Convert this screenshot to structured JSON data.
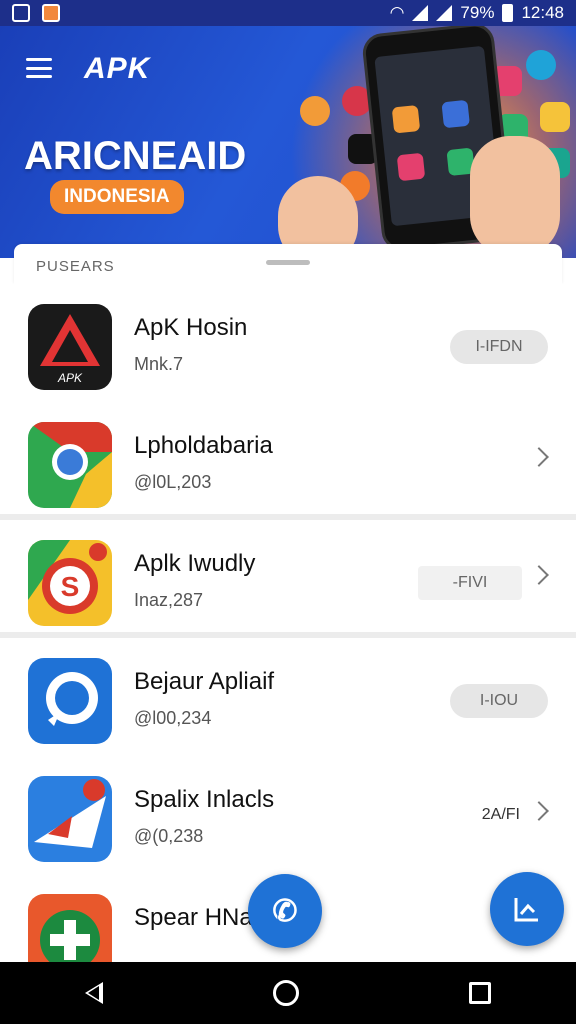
{
  "status_bar": {
    "battery": "79%",
    "time": "12:48"
  },
  "banner": {
    "brand": "APK",
    "title": "ARICNEAID",
    "tag": "INDONESIA"
  },
  "sheet": {
    "section_label": "PUSEARS"
  },
  "apps": [
    {
      "name": "ApK Hosin",
      "sub": "Mnk.7",
      "action": "I-IFDN"
    },
    {
      "name": "Lpholdabaria",
      "sub": "@l0L,203",
      "action": ""
    },
    {
      "name": "Aplk Iwudly",
      "sub": "Inaz,287",
      "action": "-FIVI"
    },
    {
      "name": "Bejaur Apliaif",
      "sub": "@l00,234",
      "action": "I-IOU"
    },
    {
      "name": "Spalix Inlacls",
      "sub": "@(0,238",
      "action": "2A/FI"
    },
    {
      "name": "Spear HNalj ai)",
      "sub": "",
      "action": ""
    }
  ],
  "colors": {
    "banner": "#2458d6",
    "accent": "#f2882e",
    "fab": "#1f72d6"
  }
}
